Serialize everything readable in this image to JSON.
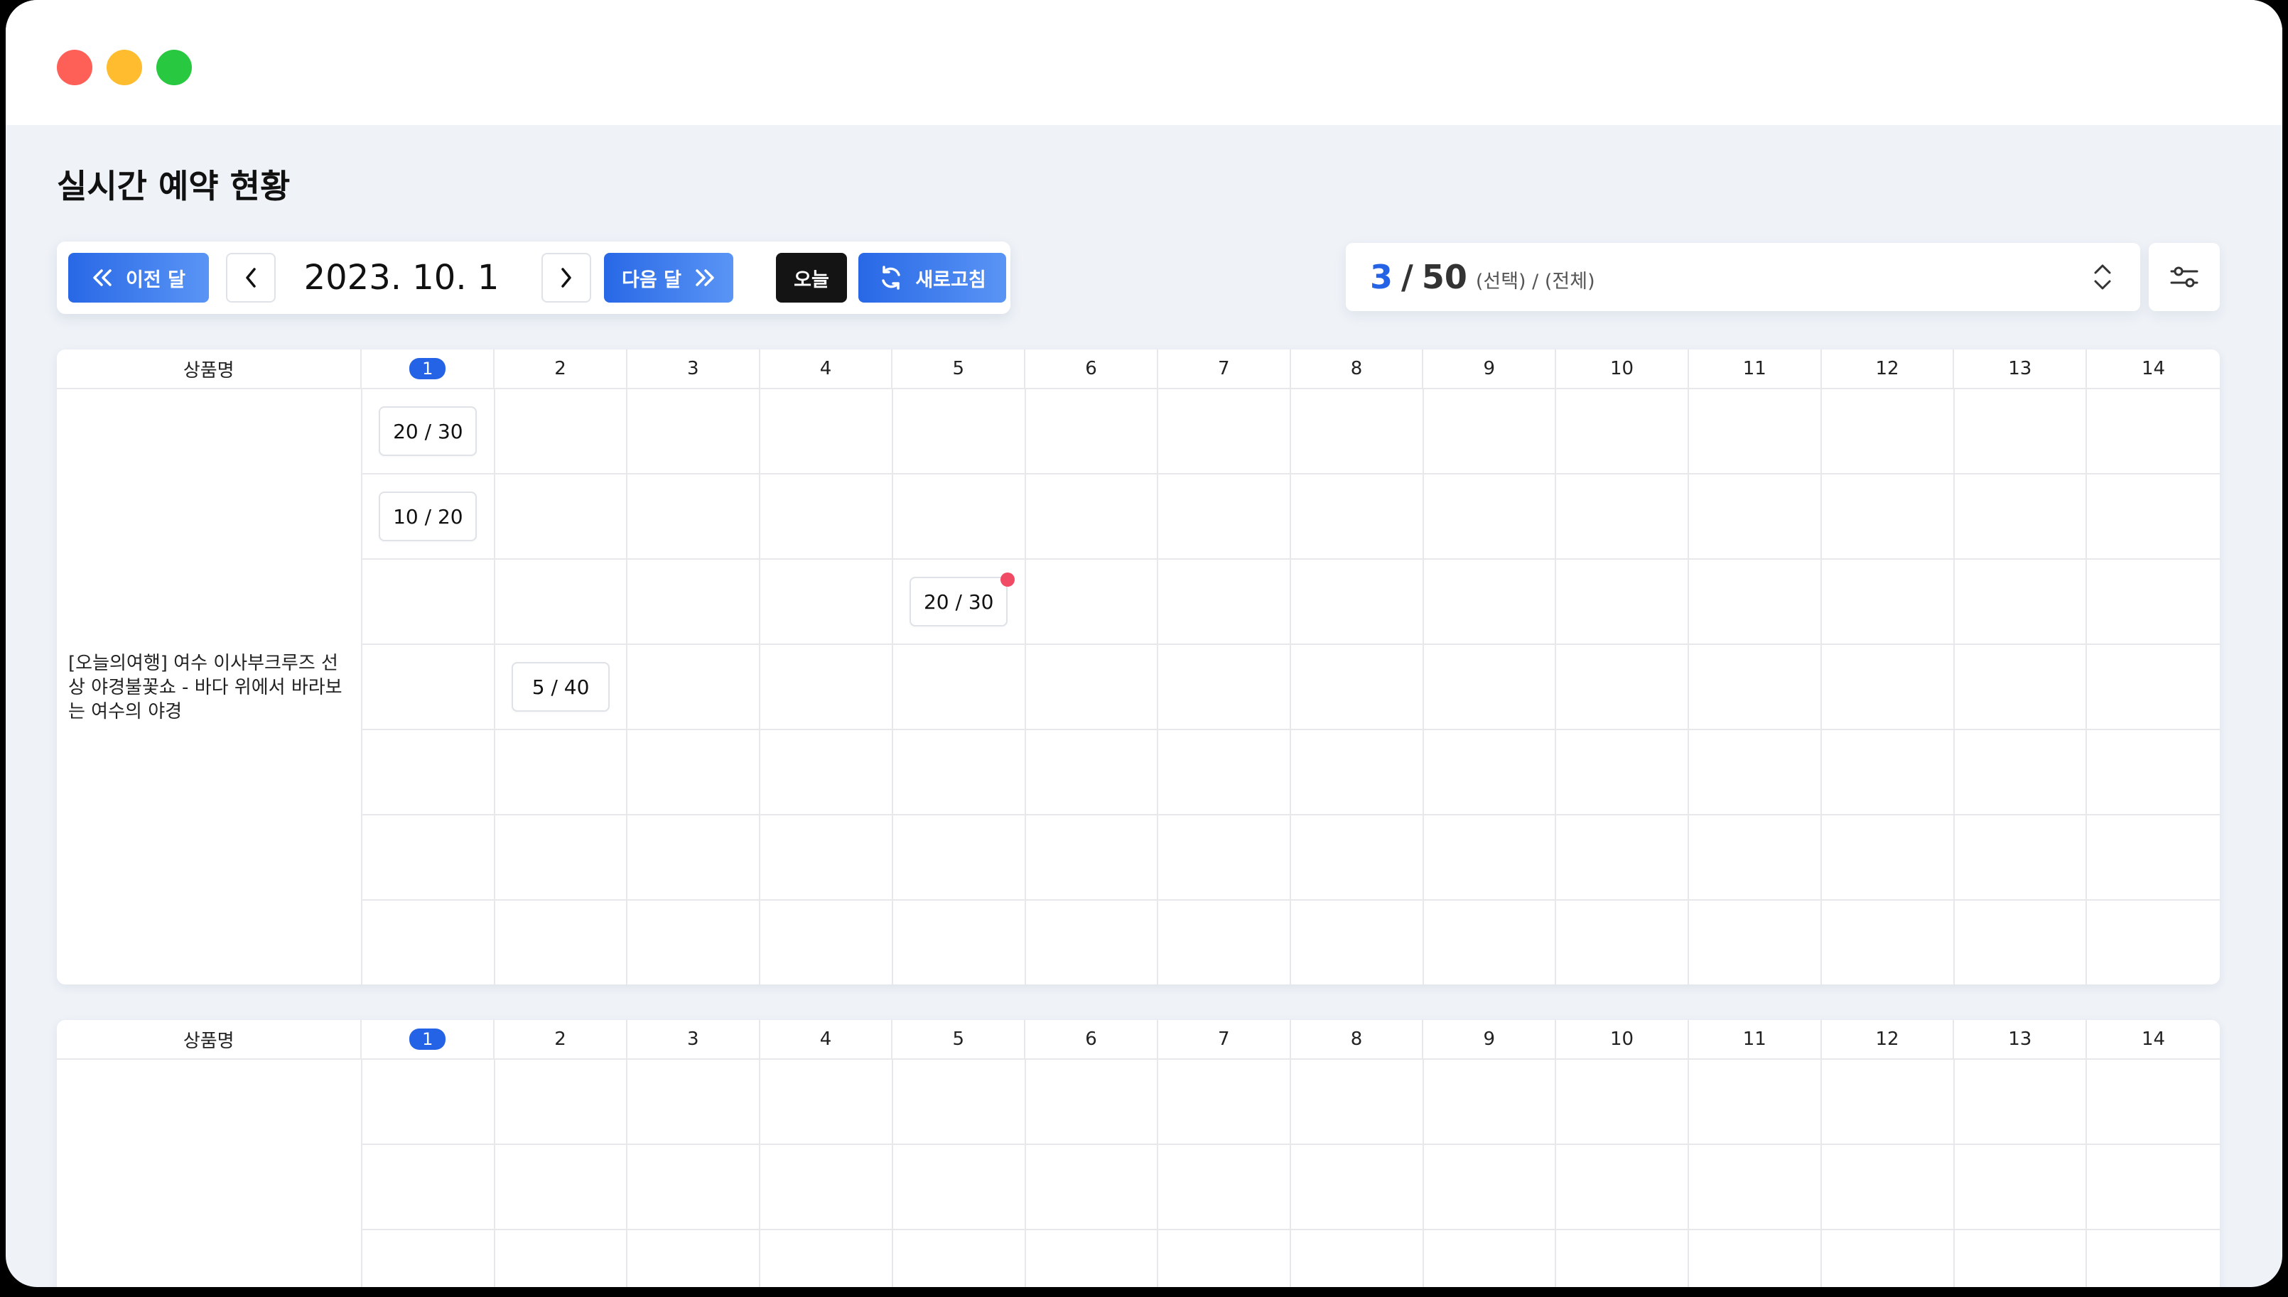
{
  "page": {
    "title": "실시간 예약 현황"
  },
  "toolbar": {
    "prev_month_label": "이전 달",
    "current_date": "2023. 10. 1",
    "next_month_label": "다음 달",
    "today_label": "오늘",
    "refresh_label": "새로고침"
  },
  "selector": {
    "selected_count": "3",
    "separator": "/",
    "total_count": "50",
    "hint": "(선택) / (전체)"
  },
  "grid": {
    "name_header": "상품명",
    "today_day": "1",
    "days": [
      "2",
      "3",
      "4",
      "5",
      "6",
      "7",
      "8",
      "9",
      "10",
      "11",
      "12",
      "13",
      "14"
    ]
  },
  "products": [
    {
      "name": "[오늘의여행] 여수 이사부크루즈 선상 야경불꽃쇼 - 바다 위에서 바라보는 여수의 야경",
      "rows": [
        {
          "slots": {
            "1": "20 / 30"
          }
        },
        {
          "slots": {
            "1": "10 / 20"
          }
        },
        {
          "slots": {
            "5": "20 / 30"
          },
          "alert_day": "5"
        },
        {
          "slots": {
            "2": "5 / 40"
          }
        },
        {
          "slots": {}
        },
        {
          "slots": {}
        },
        {
          "slots": {}
        }
      ]
    },
    {
      "name": "",
      "rows": [
        {
          "slots": {}
        },
        {
          "slots": {}
        },
        {
          "slots": {}
        }
      ]
    }
  ],
  "colors": {
    "accent": "#2563e6",
    "dark_button": "#141414",
    "alert_dot": "#f04a64",
    "background": "#eff3f8"
  },
  "icons": [
    "double-chevron-left-icon",
    "chevron-left-icon",
    "chevron-right-icon",
    "double-chevron-right-icon",
    "refresh-icon",
    "sort-updown-icon",
    "filter-sliders-icon"
  ]
}
